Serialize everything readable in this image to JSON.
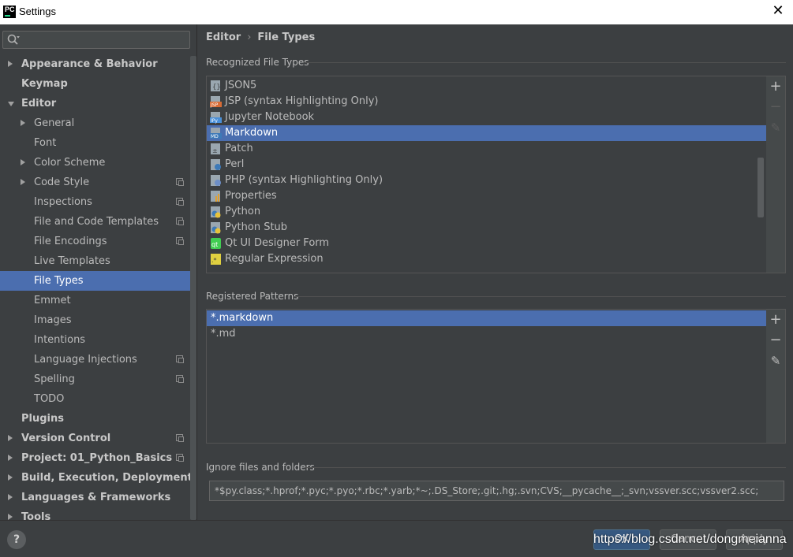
{
  "window": {
    "title": "Settings",
    "app_logo": "PC"
  },
  "sidebar": {
    "search_placeholder": "",
    "items": [
      {
        "label": "Appearance & Behavior",
        "bold": true,
        "arrow": "right"
      },
      {
        "label": "Keymap",
        "bold": true
      },
      {
        "label": "Editor",
        "bold": true,
        "arrow": "down"
      },
      {
        "label": "General",
        "arrow": "right"
      },
      {
        "label": "Font"
      },
      {
        "label": "Color Scheme",
        "arrow": "right"
      },
      {
        "label": "Code Style",
        "arrow": "right",
        "project_icon": true
      },
      {
        "label": "Inspections",
        "project_icon": true
      },
      {
        "label": "File and Code Templates",
        "project_icon": true
      },
      {
        "label": "File Encodings",
        "project_icon": true
      },
      {
        "label": "Live Templates"
      },
      {
        "label": "File Types",
        "selected": true
      },
      {
        "label": "Emmet"
      },
      {
        "label": "Images"
      },
      {
        "label": "Intentions"
      },
      {
        "label": "Language Injections",
        "project_icon": true
      },
      {
        "label": "Spelling",
        "project_icon": true
      },
      {
        "label": "TODO"
      },
      {
        "label": "Plugins",
        "bold": true
      },
      {
        "label": "Version Control",
        "bold": true,
        "arrow": "right",
        "project_icon": true
      },
      {
        "label": "Project: 01_Python_Basics",
        "bold": true,
        "arrow": "right",
        "project_icon": true
      },
      {
        "label": "Build, Execution, Deployment",
        "bold": true,
        "arrow": "right"
      },
      {
        "label": "Languages & Frameworks",
        "bold": true,
        "arrow": "right"
      },
      {
        "label": "Tools",
        "bold": true,
        "arrow": "right"
      }
    ]
  },
  "breadcrumb": {
    "parent": "Editor",
    "current": "File Types"
  },
  "recognized": {
    "title": "Recognized File Types",
    "items": [
      {
        "label": "JSON5",
        "icon": "json-file-icon"
      },
      {
        "label": "JSP (syntax Highlighting Only)",
        "icon": "jsp-file-icon"
      },
      {
        "label": "Jupyter Notebook",
        "icon": "jupyter-file-icon"
      },
      {
        "label": "Markdown",
        "icon": "markdown-file-icon",
        "selected": true
      },
      {
        "label": "Patch",
        "icon": "patch-file-icon"
      },
      {
        "label": "Perl",
        "icon": "perl-file-icon"
      },
      {
        "label": "PHP (syntax Highlighting Only)",
        "icon": "php-file-icon"
      },
      {
        "label": "Properties",
        "icon": "properties-file-icon"
      },
      {
        "label": "Python",
        "icon": "python-file-icon"
      },
      {
        "label": "Python Stub",
        "icon": "python-stub-file-icon"
      },
      {
        "label": "Qt UI Designer Form",
        "icon": "qt-file-icon"
      },
      {
        "label": "Regular Expression",
        "icon": "regexp-file-icon"
      }
    ]
  },
  "patterns": {
    "title": "Registered Patterns",
    "items": [
      {
        "label": "*.markdown",
        "selected": true
      },
      {
        "label": "*.md"
      }
    ]
  },
  "ignore": {
    "title": "Ignore files and folders",
    "value": "*$py.class;*.hprof;*.pyc;*.pyo;*.rbc;*.yarb;*~;.DS_Store;.git;.hg;.svn;CVS;__pycache__;_svn;vssver.scc;vssver2.scc;"
  },
  "tools": {
    "add": "+",
    "remove": "−",
    "edit": "✎"
  },
  "buttons": {
    "help": "?",
    "ok": "OK",
    "cancel": "Cancel",
    "apply": "Apply"
  },
  "watermark": "https://blog.csdn.net/dongmeianna",
  "colors": {
    "selection": "#4b6eaf",
    "background": "#3c3f41",
    "ok_button": "#365880"
  }
}
